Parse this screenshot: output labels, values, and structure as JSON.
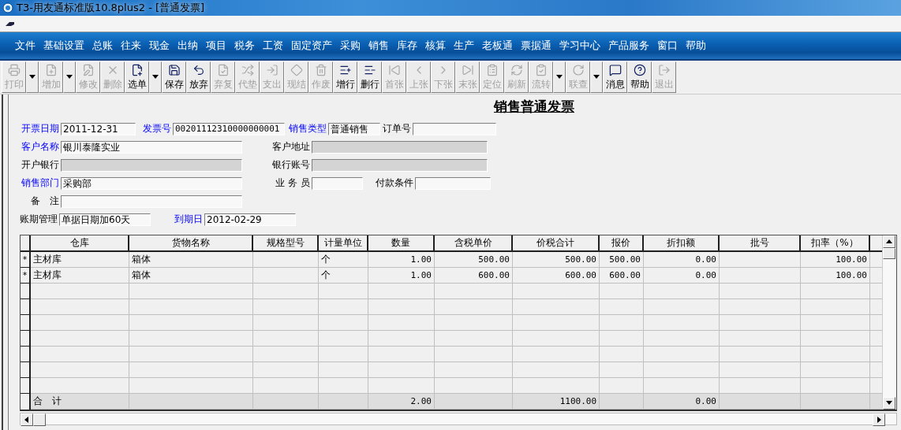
{
  "window": {
    "title": "T3-用友通标准版10.8plus2 - [普通发票]"
  },
  "menu": [
    "文件",
    "基础设置",
    "总账",
    "往来",
    "现金",
    "出纳",
    "项目",
    "税务",
    "工资",
    "固定资产",
    "采购",
    "销售",
    "库存",
    "核算",
    "生产",
    "老板通",
    "票据通",
    "学习中心",
    "产品服务",
    "窗口",
    "帮助"
  ],
  "toolbar": [
    {
      "kind": "button",
      "label": "打印",
      "disabled": true
    },
    {
      "kind": "dropdown"
    },
    {
      "kind": "button",
      "label": "增加",
      "disabled": true
    },
    {
      "kind": "dropdown"
    },
    {
      "kind": "button",
      "label": "修改",
      "disabled": true
    },
    {
      "kind": "button",
      "label": "删除",
      "disabled": true
    },
    {
      "kind": "button",
      "label": "选单",
      "disabled": false
    },
    {
      "kind": "dropdown"
    },
    {
      "kind": "button",
      "label": "保存",
      "disabled": false
    },
    {
      "kind": "button",
      "label": "放弃",
      "disabled": false
    },
    {
      "kind": "button",
      "label": "弃复",
      "disabled": true
    },
    {
      "kind": "button",
      "label": "代垫",
      "disabled": true
    },
    {
      "kind": "button",
      "label": "支出",
      "disabled": true
    },
    {
      "kind": "button",
      "label": "现结",
      "disabled": true
    },
    {
      "kind": "button",
      "label": "作废",
      "disabled": true
    },
    {
      "kind": "button",
      "label": "增行",
      "disabled": false
    },
    {
      "kind": "button",
      "label": "删行",
      "disabled": false
    },
    {
      "kind": "button",
      "label": "首张",
      "disabled": true
    },
    {
      "kind": "button",
      "label": "上张",
      "disabled": true
    },
    {
      "kind": "button",
      "label": "下张",
      "disabled": true
    },
    {
      "kind": "button",
      "label": "末张",
      "disabled": true
    },
    {
      "kind": "button",
      "label": "定位",
      "disabled": true
    },
    {
      "kind": "button",
      "label": "刷新",
      "disabled": true
    },
    {
      "kind": "button",
      "label": "流转",
      "disabled": true
    },
    {
      "kind": "dropdown"
    },
    {
      "kind": "button",
      "label": "联查",
      "disabled": true
    },
    {
      "kind": "dropdown"
    },
    {
      "kind": "button",
      "label": "消息",
      "disabled": false
    },
    {
      "kind": "button",
      "label": "帮助",
      "disabled": false
    },
    {
      "kind": "button",
      "label": "退出",
      "disabled": true
    }
  ],
  "document": {
    "title": "销售普通发票"
  },
  "form": {
    "fields": [
      {
        "label": "开票日期",
        "link": true,
        "value": "2011-12-31",
        "disabled": false
      },
      {
        "label": "发票号",
        "link": true,
        "value": "00201112310000000001",
        "disabled": false
      },
      {
        "label": "销售类型",
        "link": true,
        "value": "普通销售",
        "disabled": false
      },
      {
        "label": "订单号",
        "link": false,
        "disabled": false
      },
      {
        "label": "客户名称",
        "link": true,
        "value": "银川泰隆实业",
        "disabled": false
      },
      {
        "label": "客户地址",
        "link": false,
        "disabled": true
      },
      {
        "label": "开户银行",
        "link": false,
        "disabled": true
      },
      {
        "label": "银行账号",
        "link": false,
        "disabled": true
      },
      {
        "label": "销售部门",
        "link": true,
        "value": "采购部",
        "disabled": false
      },
      {
        "label": "业 务 员",
        "link": false,
        "disabled": false
      },
      {
        "label": "付款条件",
        "link": false,
        "disabled": false
      },
      {
        "label": "备　注",
        "link": false,
        "disabled": false
      },
      {
        "label": "账期管理",
        "link": false,
        "value": "单据日期加60天",
        "disabled": false
      },
      {
        "label": "到期日",
        "link": true,
        "value": "2012-02-29",
        "disabled": false
      }
    ]
  },
  "table": {
    "columns": [
      "仓库",
      "货物名称",
      "规格型号",
      "计量单位",
      "数量",
      "含税单价",
      "价税合计",
      "报价",
      "折扣额",
      "批号",
      "扣率（%）"
    ],
    "rows": [
      {
        "marker": "*",
        "cells": [
          "主材库",
          "箱体",
          null,
          "个",
          "1.00",
          "500.00",
          "500.00",
          "500.00",
          "0.00",
          null,
          "100.00"
        ]
      },
      {
        "marker": "*",
        "cells": [
          "主材库",
          "箱体",
          null,
          "个",
          "1.00",
          "600.00",
          "600.00",
          "600.00",
          "0.00",
          null,
          "100.00"
        ]
      }
    ],
    "total": {
      "label": "合　计",
      "cells": [
        null,
        null,
        null,
        "2.00",
        null,
        "1100.00",
        null,
        "0.00",
        null,
        null
      ]
    }
  }
}
